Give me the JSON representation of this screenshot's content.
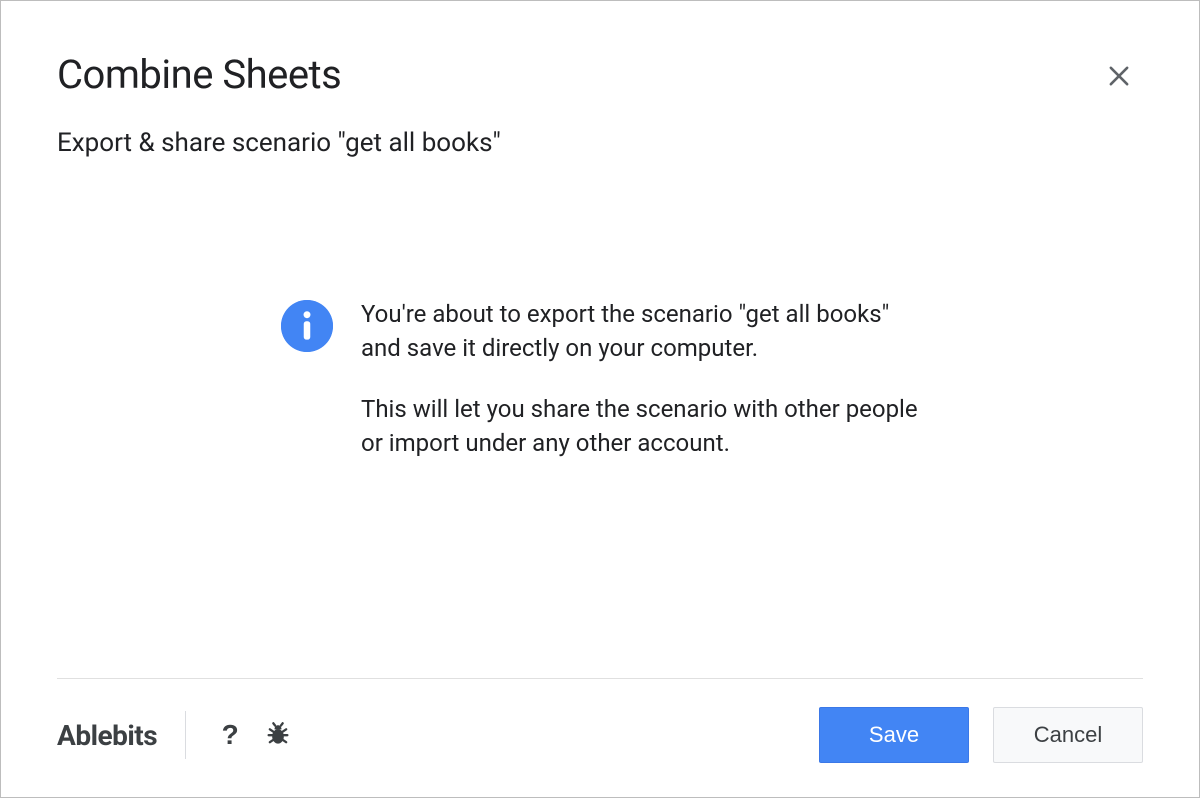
{
  "dialog": {
    "title": "Combine Sheets",
    "subtitle": "Export & share scenario \"get all books\""
  },
  "message": {
    "para1": "You're about to export the scenario \"get all books\" and save it directly on your computer.",
    "para2": "This will let you share the scenario with other people or import under any other account."
  },
  "footer": {
    "brand": "Ablebits",
    "help_label": "?",
    "save_label": "Save",
    "cancel_label": "Cancel"
  }
}
